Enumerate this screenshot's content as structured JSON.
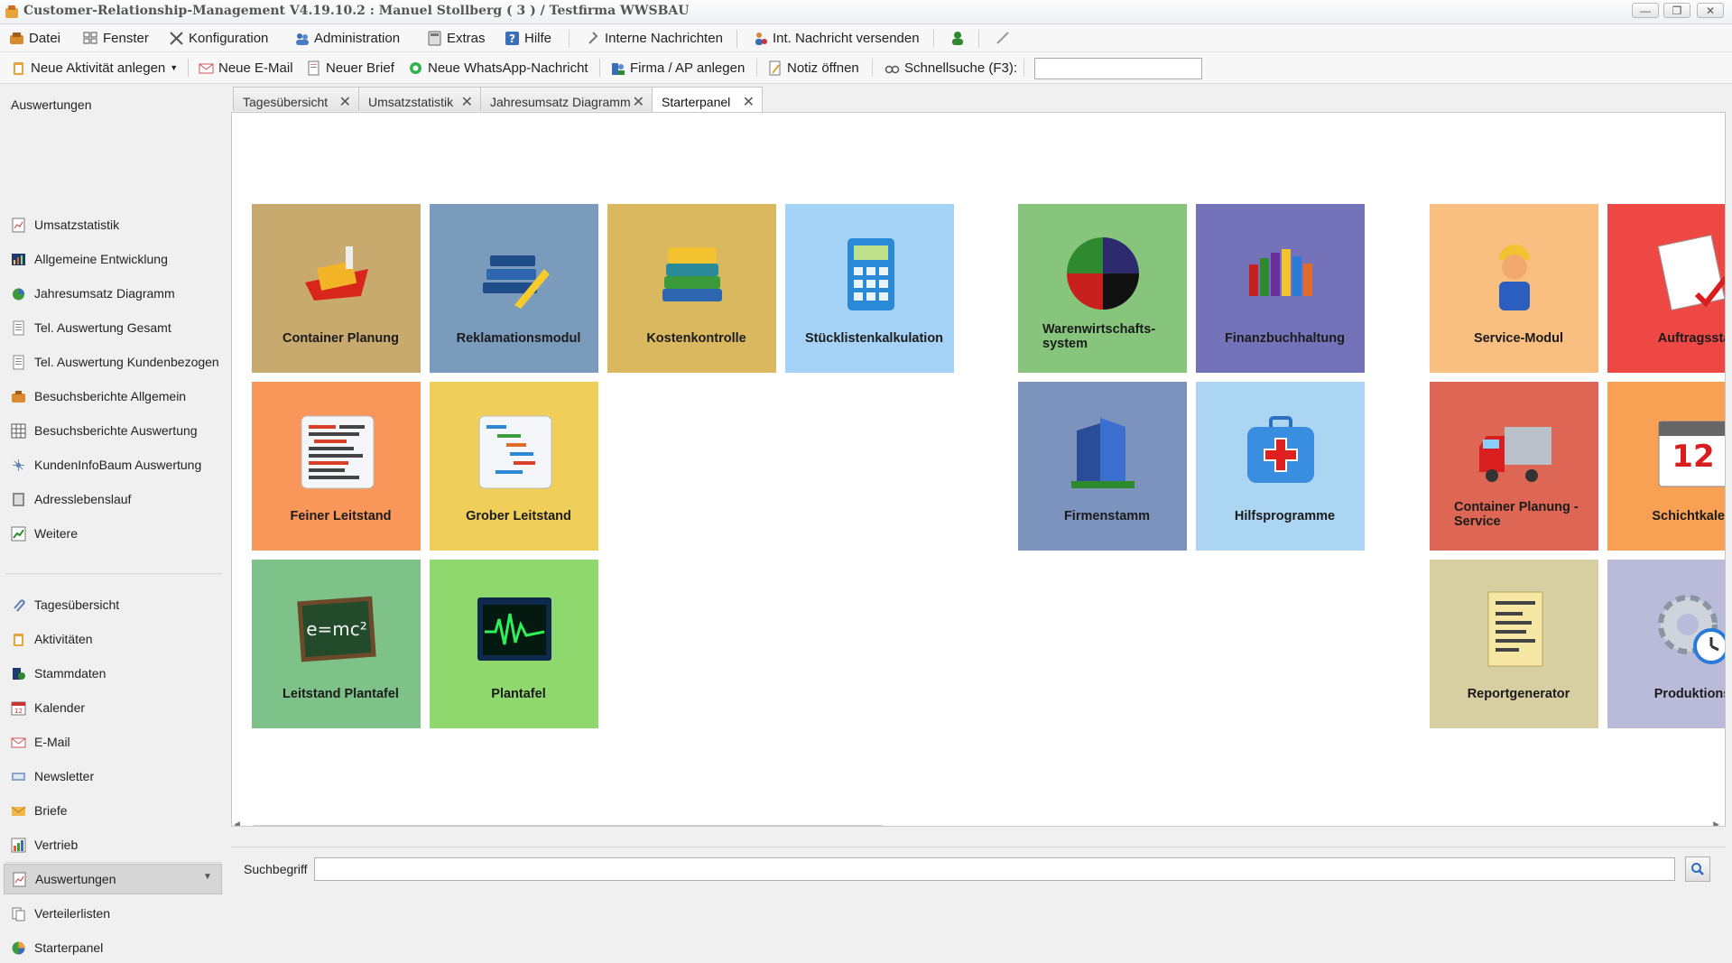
{
  "window": {
    "title": "Customer-Relationship-Management V4.19.10.2 : Manuel Stollberg ( 3 ) / Testfirma WWSBAU"
  },
  "menubar": {
    "items": [
      {
        "label": "Datei",
        "icon": "app-icon"
      },
      {
        "label": "Fenster",
        "icon": "windows-icon"
      },
      {
        "label": "Konfiguration",
        "icon": "tools-icon"
      },
      {
        "label": "Administration",
        "icon": "users-icon"
      },
      {
        "label": "Extras",
        "icon": "calculator-icon"
      },
      {
        "label": "Hilfe",
        "icon": "help-icon"
      },
      {
        "label": "Interne Nachrichten",
        "icon": "pin-icon"
      },
      {
        "label": "Int. Nachricht versenden",
        "icon": "user-message-icon"
      }
    ]
  },
  "toolbar": {
    "new_activity": "Neue Aktivität anlegen",
    "new_email": "Neue E-Mail",
    "new_letter": "Neuer Brief",
    "new_whatsapp": "Neue WhatsApp-Nachricht",
    "company": "Firma / AP anlegen",
    "note": "Notiz öffnen",
    "quicksearch": "Schnellsuche (F3):",
    "quicksearch_value": ""
  },
  "sidebar": {
    "header": "Auswertungen",
    "reports": [
      "Umsatzstatistik",
      "Allgemeine Entwicklung",
      "Jahresumsatz Diagramm",
      "Tel. Auswertung Gesamt",
      "Tel. Auswertung Kundenbezogen",
      "Besuchsberichte Allgemein",
      "Besuchsberichte Auswertung",
      "KundenInfoBaum Auswertung",
      "Adresslebenslauf",
      "Weitere"
    ],
    "modules": [
      "Tagesübersicht",
      "Aktivitäten",
      "Stammdaten",
      "Kalender",
      "E-Mail",
      "Newsletter",
      "Briefe",
      "Vertrieb",
      "Auswertungen",
      "Verteilerlisten",
      "Starterpanel"
    ],
    "active_module": "Auswertungen"
  },
  "tabs": [
    "Tagesübersicht",
    "Umsatzstatistik",
    "Jahresumsatz Diagramm",
    "Starterpanel"
  ],
  "active_tab": "Starterpanel",
  "tiles": [
    {
      "label": "Container Planung",
      "color": "#c8a96e",
      "icon": "ship-icon"
    },
    {
      "label": "Reklamationsmodul",
      "color": "#7b9bbd",
      "icon": "books-pen-icon"
    },
    {
      "label": "Kostenkontrolle",
      "color": "#d9b860",
      "icon": "book-stack-icon"
    },
    {
      "label": "Stücklistenkalkulation",
      "color": "#a4d3f7",
      "icon": "calculator-icon"
    },
    {
      "label": "Warenwirtschafts-system",
      "color": "#86c57b",
      "icon": "pie-icon"
    },
    {
      "label": "Finanzbuchhaltung",
      "color": "#7473b9",
      "icon": "binders-icon"
    },
    {
      "label": "Service-Modul",
      "color": "#f8bf80",
      "icon": "worker-icon"
    },
    {
      "label": "Auftragsstat",
      "color": "#ee4845",
      "icon": "checklist-icon"
    },
    {
      "label": "Feiner Leitstand",
      "color": "#f9965a",
      "icon": "gantt-fine-icon"
    },
    {
      "label": "Grober Leitstand",
      "color": "#f0ce5a",
      "icon": "gantt-coarse-icon"
    },
    {
      "label": "Firmenstamm",
      "color": "#7c93bd",
      "icon": "building-icon"
    },
    {
      "label": "Hilfsprogramme",
      "color": "#acd5f3",
      "icon": "first-aid-icon"
    },
    {
      "label": "Container Planung - Service",
      "color": "#dd6754",
      "icon": "truck-icon"
    },
    {
      "label": "Schichtkalend",
      "color": "#f8a054",
      "icon": "calendar-icon"
    },
    {
      "label": "Leitstand Plantafel",
      "color": "#7ec189",
      "icon": "chalkboard-icon"
    },
    {
      "label": "Plantafel",
      "color": "#8fd86d",
      "icon": "monitor-wave-icon"
    },
    {
      "label": "Reportgenerator",
      "color": "#d7cfa2",
      "icon": "report-icon"
    },
    {
      "label": "Produktionsp",
      "color": "#babad9",
      "icon": "gear-clock-icon"
    }
  ],
  "search": {
    "label": "Suchbegriff",
    "value": ""
  }
}
